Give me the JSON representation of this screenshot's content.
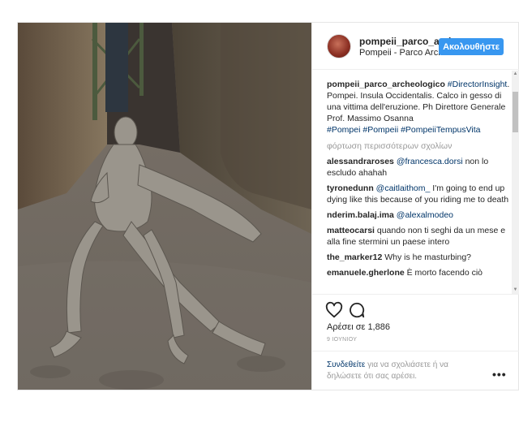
{
  "post": {
    "username": "pompeii_parco_archeologico",
    "location": "Pompeii - Parco Archeologico",
    "follow_label": "Ακολουθήστε",
    "caption": {
      "username": "pompeii_parco_archeologico",
      "tag_director": "#DirectorInsight",
      "text": ". Pompei. Insula Occidentalis. Calco in gesso di una vittima dell'eruzione. Ph Direttore Generale Prof. Massimo Osanna",
      "tag_1": "#Pompei",
      "tag_2": "#Pompeii",
      "tag_3": "#PompeiiTempusVita"
    },
    "load_more": "φόρτωση περισσότερων σχολίων",
    "comments": [
      {
        "user": "alessandraroses",
        "mention": "@francesca.dorsi",
        "text": " non lo escludo ahahah"
      },
      {
        "user": "tyronedunn",
        "mention": "@caitlaithom_",
        "text": " I'm going to end up dying like this because of you riding me to death"
      },
      {
        "user": "nderim.balaj.ima",
        "mention": "@alexalmodeo",
        "text": ""
      },
      {
        "user": "matteocarsi",
        "mention": "",
        "text": "quando non ti seghi da un mese e alla fine stermini un paese intero"
      },
      {
        "user": "the_marker12",
        "mention": "",
        "text": "Why is he masturbing?"
      },
      {
        "user": "emanuele.gherlone",
        "mention": "",
        "text": "È morto facendo ciò"
      }
    ],
    "likes": "Αρέσει σε 1,886",
    "date": "9 ΙΟΥΝΙΟΥ",
    "login_link": "Συνδεθείτε",
    "login_text": " για να σχολιάσετε ή να δηλώσετε ότι σας αρέσει.",
    "more_label": "•••",
    "icons": {
      "like": "heart-icon",
      "comment": "comment-bubble-icon",
      "more": "more-options-icon"
    }
  }
}
